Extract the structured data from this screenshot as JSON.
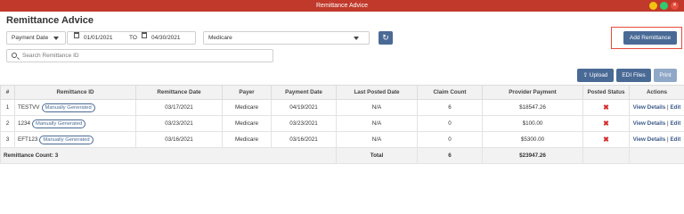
{
  "window": {
    "title": "Remittance Advice",
    "close_glyph": "×"
  },
  "page": {
    "title": "Remittance Advice"
  },
  "filters": {
    "date_type": "Payment Date",
    "date_from": "01/01/2021",
    "to_label": "TO",
    "date_to": "04/30/2021",
    "payer": "Medicare",
    "refresh_glyph": "↻"
  },
  "search": {
    "placeholder": "Search Remittance ID"
  },
  "actions": {
    "add_label": "Add Remittance",
    "upload_label": "Upload",
    "edi_label": "EDI Files",
    "print_label": "Print"
  },
  "table": {
    "headers": [
      "#",
      "Remittance ID",
      "Remittance Date",
      "Payer",
      "Payment Date",
      "Last Posted Date",
      "Claim Count",
      "Provider Payment",
      "Posted Status",
      "Actions"
    ],
    "rows": [
      {
        "num": "1",
        "id": "TESTVV",
        "tag": "Manually Generated",
        "remit_date": "03/17/2021",
        "payer": "Medicare",
        "payment_date": "04/19/2021",
        "last_posted": "N/A",
        "claim_count": "6",
        "payment": "$18547.26",
        "status_glyph": "✖",
        "view": "View Details",
        "sep": "|",
        "edit": "Edit"
      },
      {
        "num": "2",
        "id": "1234",
        "tag": "Manually Generated",
        "remit_date": "03/23/2021",
        "payer": "Medicare",
        "payment_date": "03/23/2021",
        "last_posted": "N/A",
        "claim_count": "0",
        "payment": "$100.00",
        "status_glyph": "✖",
        "view": "View Details",
        "sep": "|",
        "edit": "Edit"
      },
      {
        "num": "3",
        "id": "EFT123",
        "tag": "Manually Generated",
        "remit_date": "03/16/2021",
        "payer": "Medicare",
        "payment_date": "03/16/2021",
        "last_posted": "N/A",
        "claim_count": "0",
        "payment": "$5300.00",
        "status_glyph": "✖",
        "view": "View Details",
        "sep": "|",
        "edit": "Edit"
      }
    ],
    "footer": {
      "count_label": "Remittance Count: 3",
      "total_label": "Total",
      "claim_total": "6",
      "payment_total": "$23947.26"
    }
  }
}
